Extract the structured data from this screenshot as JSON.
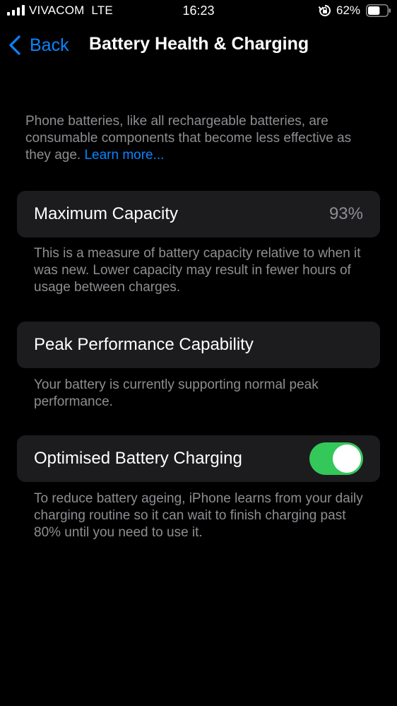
{
  "status_bar": {
    "carrier": "VIVACOM",
    "network": "LTE",
    "time": "16:23",
    "battery_percent": "62%",
    "battery_level": 0.62,
    "icons": [
      "signal-icon",
      "rotation-lock-icon",
      "battery-icon"
    ]
  },
  "nav": {
    "back_label": "Back",
    "title": "Battery Health & Charging",
    "icon": "chevron-left-icon"
  },
  "intro": {
    "text": "Phone batteries, like all rechargeable batteries, are consumable components that become less effective as they age. ",
    "link": "Learn more..."
  },
  "max_capacity": {
    "label": "Maximum Capacity",
    "value": "93%",
    "footer": "This is a measure of battery capacity relative to when it was new. Lower capacity may result in fewer hours of usage between charges."
  },
  "peak_performance": {
    "label": "Peak Performance Capability",
    "footer": "Your battery is currently supporting normal peak performance."
  },
  "optimised_charging": {
    "label": "Optimised Battery Charging",
    "enabled": true,
    "footer": "To reduce battery ageing, iPhone learns from your daily charging routine so it can wait to finish charging past 80% until you need to use it."
  },
  "colors": {
    "background": "#000000",
    "cell": "#1c1c1e",
    "accent": "#0a84ff",
    "toggle_on": "#34c759",
    "secondary_text": "#8e8e93"
  }
}
